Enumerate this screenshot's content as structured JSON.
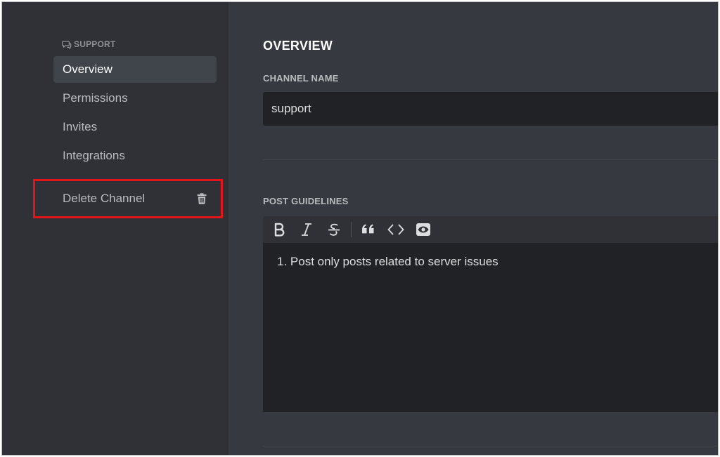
{
  "sidebar": {
    "category": "SUPPORT",
    "items": [
      {
        "label": "Overview",
        "active": true
      },
      {
        "label": "Permissions"
      },
      {
        "label": "Invites"
      },
      {
        "label": "Integrations"
      }
    ],
    "delete_label": "Delete Channel"
  },
  "main": {
    "title": "OVERVIEW",
    "channel_name_label": "CHANNEL NAME",
    "channel_name_value": "support",
    "guidelines_label": "POST GUIDELINES",
    "toolbar": [
      "bold-icon",
      "italic-icon",
      "strikethrough-icon",
      "quote-icon",
      "code-icon",
      "preview-eye-icon"
    ],
    "guidelines_text": "1. Post only posts related to server issues"
  },
  "colors": {
    "sidebar_bg": "#2f3136",
    "main_bg": "#36393f",
    "input_bg": "#202225",
    "highlight": "#e3151a"
  }
}
